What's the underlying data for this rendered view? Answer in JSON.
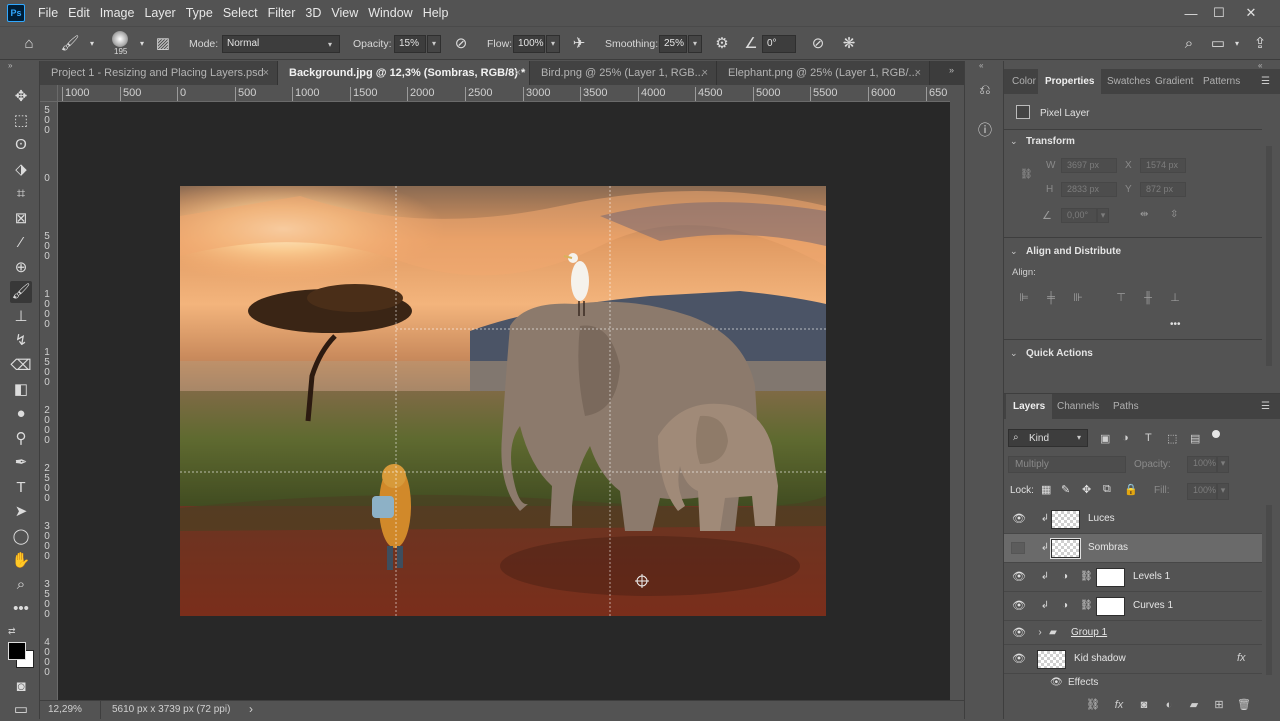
{
  "app": {
    "logo": "Ps"
  },
  "menu": [
    "File",
    "Edit",
    "Image",
    "Layer",
    "Type",
    "Select",
    "Filter",
    "3D",
    "View",
    "Window",
    "Help"
  ],
  "window_controls": {
    "minimize": "—",
    "maximize": "☐",
    "close": "✕"
  },
  "options": {
    "brush_size": "195",
    "mode_label": "Mode:",
    "mode_value": "Normal",
    "opacity_label": "Opacity:",
    "opacity_value": "15%",
    "flow_label": "Flow:",
    "flow_value": "100%",
    "smoothing_label": "Smoothing:",
    "smoothing_value": "25%",
    "angle_value": "0°"
  },
  "tabs": [
    {
      "label": "Project 1 - Resizing and Placing Layers.psd",
      "close": "×"
    },
    {
      "label": "Background.jpg @ 12,3% (Sombras, RGB/8) *",
      "close": "×"
    },
    {
      "label": "Bird.png @ 25% (Layer 1, RGB...",
      "close": "×"
    },
    {
      "label": "Elephant.png @ 25% (Layer 1, RGB/...",
      "close": "×"
    }
  ],
  "ruler_h": [
    "1000",
    "500",
    "0",
    "500",
    "1000",
    "1500",
    "2000",
    "2500",
    "3000",
    "3500",
    "4000",
    "4500",
    "5000",
    "5500",
    "6000",
    "650"
  ],
  "ruler_v": [
    "500",
    "0",
    "500",
    "1000",
    "1500",
    "2000",
    "2500",
    "3000",
    "3500",
    "4000"
  ],
  "status": {
    "zoom": "12,29%",
    "dimensions": "5610 px x 3739 px (72 ppi)",
    "arrow": "›"
  },
  "properties": {
    "tabs": [
      "Color",
      "Properties",
      "Swatches",
      "Gradient",
      "Patterns"
    ],
    "layer_type": "Pixel Layer",
    "transform_title": "Transform",
    "w_label": "W",
    "w_value": "3697 px",
    "x_label": "X",
    "x_value": "1574 px",
    "h_label": "H",
    "h_value": "2833 px",
    "y_label": "Y",
    "y_value": "872 px",
    "angle_value": "0,00°",
    "align_title": "Align and Distribute",
    "align_label": "Align:",
    "more": "•••",
    "quick_actions_title": "Quick Actions"
  },
  "layers_panel": {
    "tabs": [
      "Layers",
      "Channels",
      "Paths"
    ],
    "filter_kind": "Kind",
    "blend_mode": "Multiply",
    "opacity_label": "Opacity:",
    "opacity_value": "100%",
    "lock_label": "Lock:",
    "fill_label": "Fill:",
    "fill_value": "100%",
    "layers": [
      {
        "name": "Luces"
      },
      {
        "name": "Sombras"
      },
      {
        "name": "Levels 1"
      },
      {
        "name": "Curves 1"
      },
      {
        "name": "Group 1"
      },
      {
        "name": "Kid shadow"
      }
    ],
    "effects_label": "Effects",
    "fx_label": "fx"
  }
}
